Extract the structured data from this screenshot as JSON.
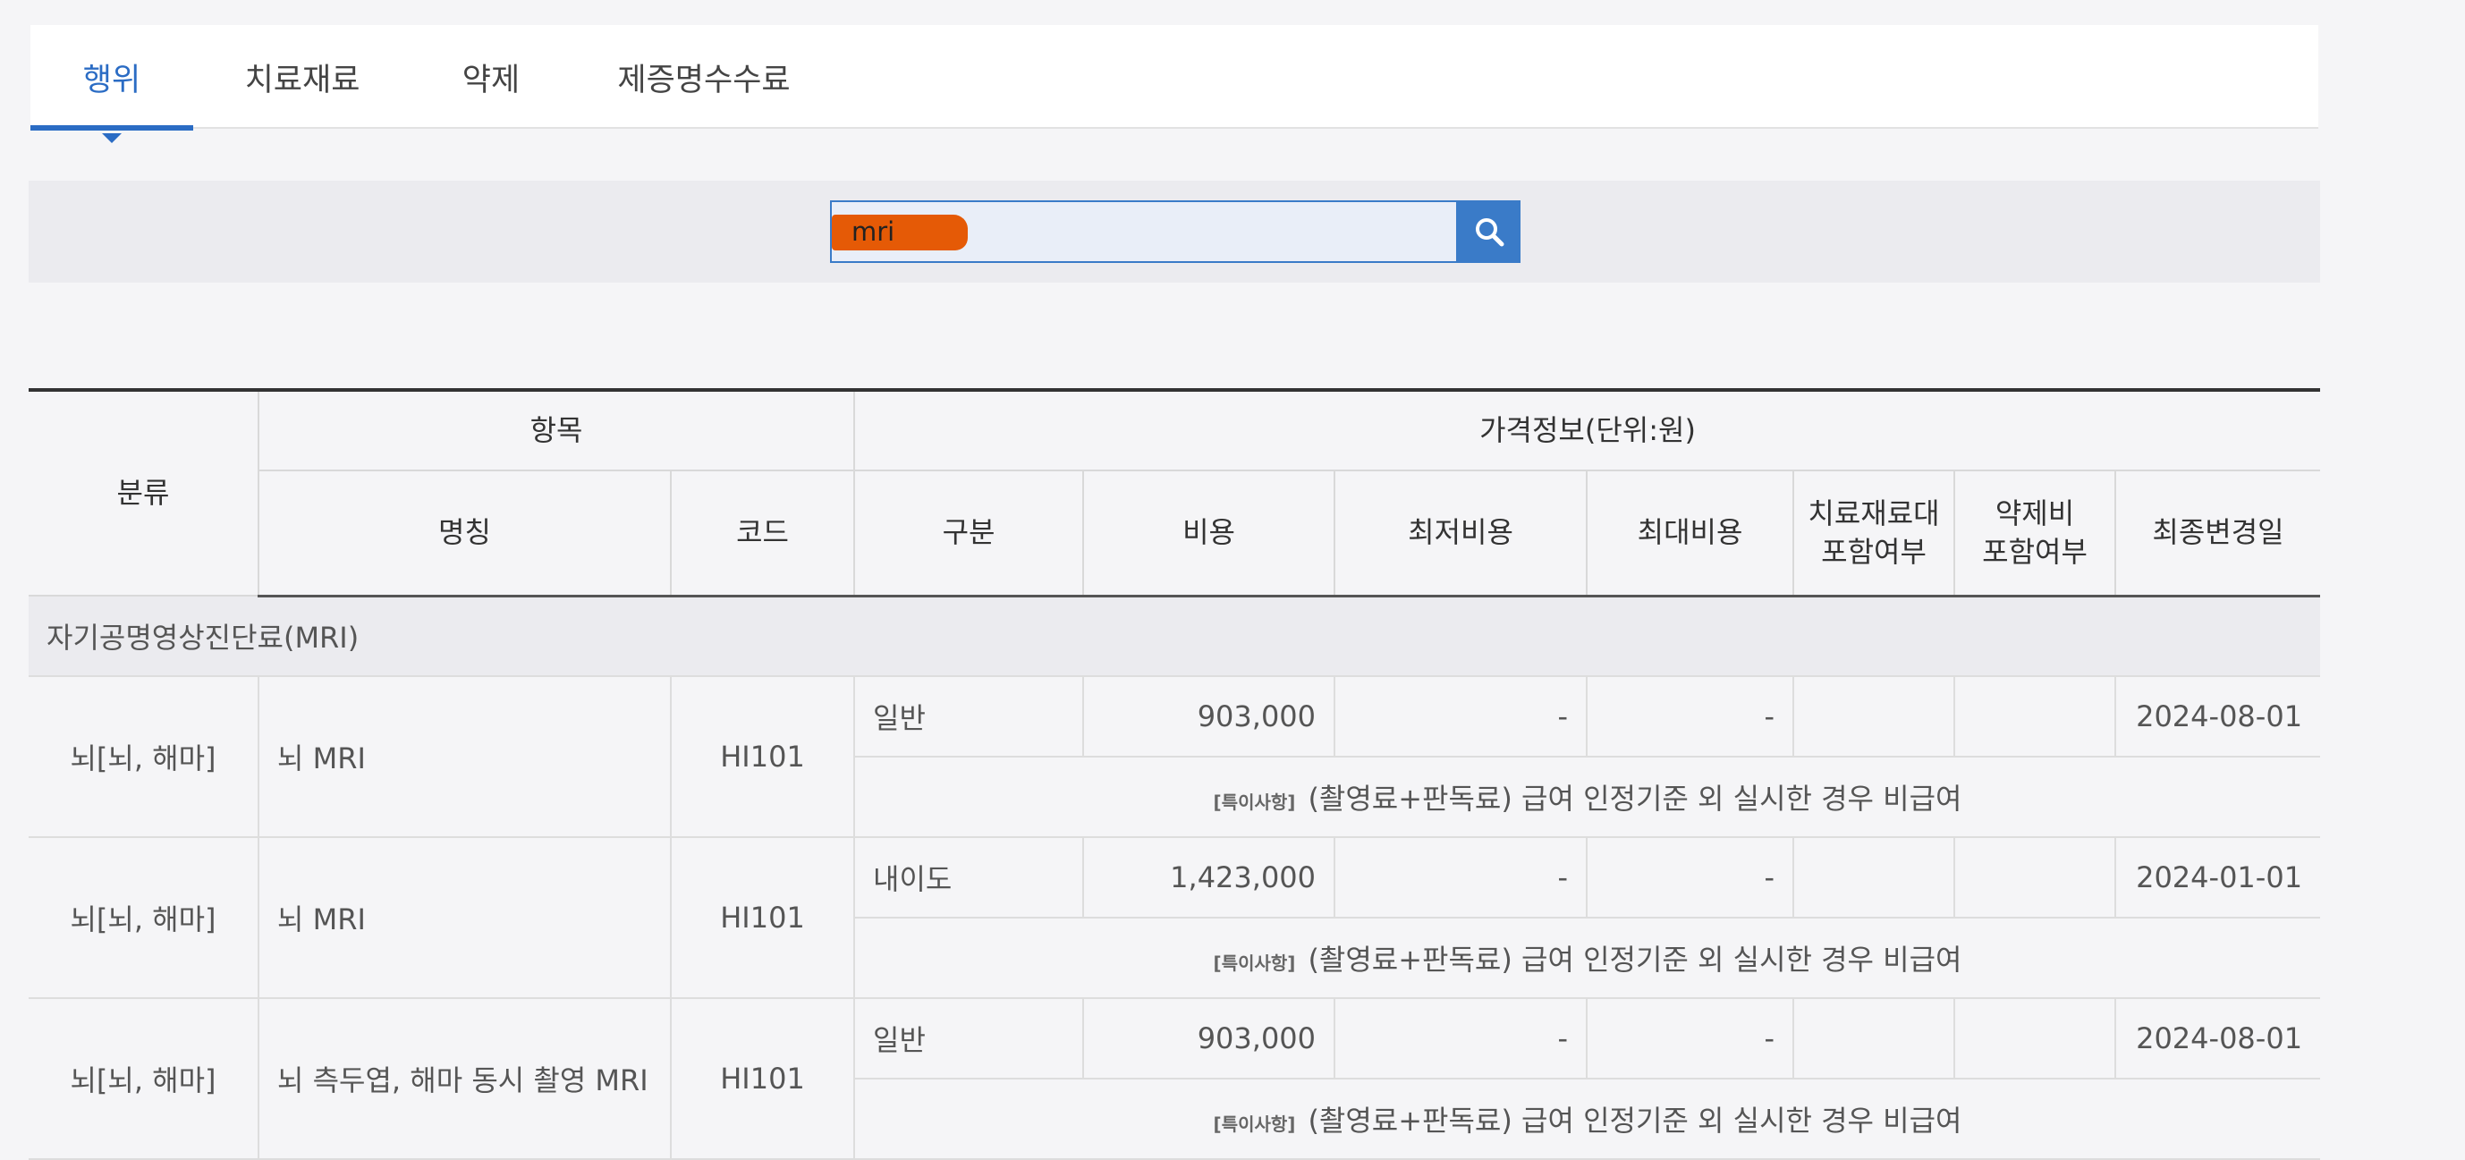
{
  "tabs": [
    {
      "label": "행위",
      "active": true
    },
    {
      "label": "치료재료",
      "active": false
    },
    {
      "label": "약제",
      "active": false
    },
    {
      "label": "제증명수수료",
      "active": false
    }
  ],
  "search": {
    "value": "mri"
  },
  "table": {
    "headers": {
      "category": "분류",
      "item_group": "항목",
      "price_group": "가격정보(단위:원)",
      "name": "명칭",
      "code": "코드",
      "type": "구분",
      "cost": "비용",
      "min_cost": "최저비용",
      "max_cost": "최대비용",
      "material_included_1": "치료재료대",
      "material_included_2": "포함여부",
      "drug_included_1": "약제비",
      "drug_included_2": "포함여부",
      "last_modified": "최종변경일"
    },
    "group_label": "자기공명영상진단료(MRI)",
    "note_label": "[특이사항]",
    "rows": [
      {
        "category": "뇌[뇌, 해마]",
        "name": "뇌 MRI",
        "code": "HI101",
        "type": "일반",
        "cost": "903,000",
        "min_cost": "-",
        "max_cost": "-",
        "material": "",
        "drug": "",
        "date": "2024-08-01",
        "note": "(촬영료+판독료) 급여 인정기준 외 실시한 경우 비급여"
      },
      {
        "category": "뇌[뇌, 해마]",
        "name": "뇌 MRI",
        "code": "HI101",
        "type": "내이도",
        "cost": "1,423,000",
        "min_cost": "-",
        "max_cost": "-",
        "material": "",
        "drug": "",
        "date": "2024-01-01",
        "note": "(촬영료+판독료) 급여 인정기준 외 실시한 경우 비급여"
      },
      {
        "category": "뇌[뇌, 해마]",
        "name": "뇌 측두엽, 해마 동시 촬영 MRI",
        "code": "HI101",
        "type": "일반",
        "cost": "903,000",
        "min_cost": "-",
        "max_cost": "-",
        "material": "",
        "drug": "",
        "date": "2024-08-01",
        "note": "(촬영료+판독료) 급여 인정기준 외 실시한 경우 비급여"
      }
    ]
  },
  "colors": {
    "accent": "#2b6cc4",
    "search_button": "#3a7bc8",
    "redaction": "#e55a06"
  },
  "icons": {
    "search_button": "search-icon",
    "active_tab_marker": "caret-down-icon"
  }
}
